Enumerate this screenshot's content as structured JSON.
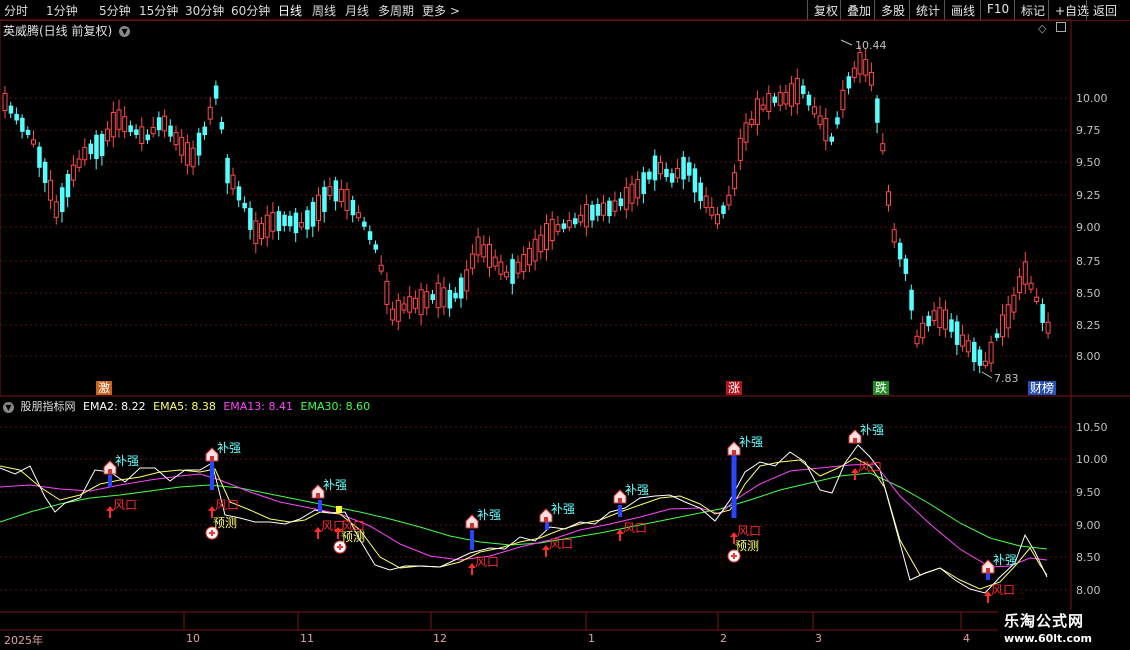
{
  "toolbar": {
    "periods": [
      "分时",
      "1分钟",
      "5分钟",
      "15分钟",
      "30分钟",
      "60分钟",
      "日线",
      "周线",
      "月线",
      "多周期",
      "更多 >"
    ],
    "active_period": "日线",
    "right_buttons": [
      "复权",
      "叠加",
      "多股",
      "统计",
      "画线",
      "F10",
      "标记",
      "+自选",
      "返回"
    ]
  },
  "main_chart": {
    "title": "英威腾(日线 前复权)",
    "high_label": "10.44",
    "low_label": "7.83",
    "price_ticks": [
      "10.00",
      "9.75",
      "9.50",
      "9.25",
      "9.00",
      "8.75",
      "8.50",
      "8.25",
      "8.00"
    ],
    "event_tags": [
      {
        "text": "激",
        "color": "#c8641e"
      },
      {
        "text": "涨",
        "color": "#b4141e"
      },
      {
        "text": "跌",
        "color": "#1e8c1e"
      },
      {
        "text": "财榜",
        "color": "#2850b4"
      }
    ]
  },
  "indicator": {
    "name": "股朋指标网",
    "ema2_label": "EMA2: 8.22",
    "ema5_label": "EMA5: 8.38",
    "ema13_label": "EMA13: 8.41",
    "ema30_label": "EMA30: 8.60",
    "ticks": [
      "10.50",
      "10.00",
      "9.50",
      "9.00",
      "8.50",
      "8.00"
    ],
    "signal_texts": {
      "strong": "补强",
      "wind": "风口",
      "predict": "预测"
    }
  },
  "x_axis": {
    "labels": [
      "2025年",
      "10",
      "11",
      "12",
      "1",
      "2",
      "3",
      "4"
    ]
  },
  "watermark": {
    "line1": "乐淘公式网",
    "line2": "www.60lt.com"
  },
  "colors": {
    "up": "#ff4a4a",
    "down": "#54ffff",
    "ema2": "#ffffff",
    "ema5": "#ffff66",
    "ema13": "#ff44ff",
    "ema30": "#44ff44",
    "grid": "#5a1010"
  }
}
